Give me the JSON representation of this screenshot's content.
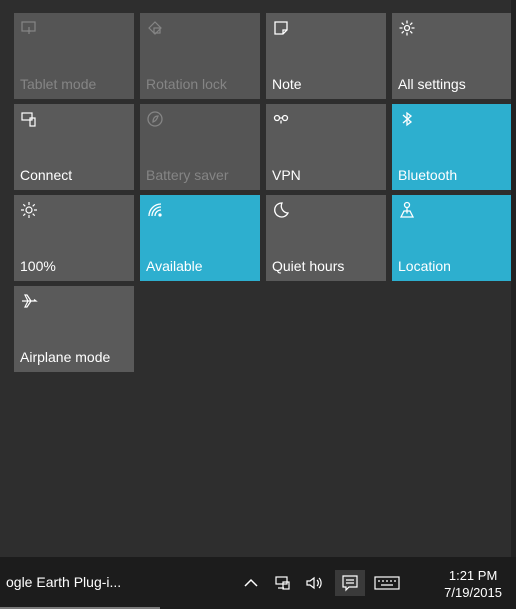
{
  "tiles": [
    {
      "label": "Tablet mode",
      "icon": "tablet-mode-icon",
      "state": "disabled"
    },
    {
      "label": "Rotation lock",
      "icon": "rotation-lock-icon",
      "state": "disabled"
    },
    {
      "label": "Note",
      "icon": "note-icon",
      "state": "off"
    },
    {
      "label": "All settings",
      "icon": "gear-icon",
      "state": "off"
    },
    {
      "label": "Connect",
      "icon": "connect-icon",
      "state": "off"
    },
    {
      "label": "Battery saver",
      "icon": "battery-saver-icon",
      "state": "disabled"
    },
    {
      "label": "VPN",
      "icon": "vpn-icon",
      "state": "off"
    },
    {
      "label": "Bluetooth",
      "icon": "bluetooth-icon",
      "state": "on"
    },
    {
      "label": "100%",
      "icon": "brightness-icon",
      "state": "off"
    },
    {
      "label": "Available",
      "icon": "wifi-icon",
      "state": "on"
    },
    {
      "label": "Quiet hours",
      "icon": "moon-icon",
      "state": "off"
    },
    {
      "label": "Location",
      "icon": "location-icon",
      "state": "on"
    },
    {
      "label": "Airplane mode",
      "icon": "airplane-icon",
      "state": "off"
    }
  ],
  "taskbar": {
    "app_label": "ogle Earth Plug-i...",
    "clock": {
      "time": "1:21 PM",
      "date": "7/19/2015"
    },
    "tray_icons": [
      "chevron-up-icon",
      "network-icon",
      "volume-icon",
      "action-center-icon",
      "keyboard-icon"
    ]
  },
  "colors": {
    "accent": "#2dafcf",
    "tile_off": "#5a5a5a",
    "panel": "#2e2e2e",
    "taskbar": "#1c1c1c"
  }
}
